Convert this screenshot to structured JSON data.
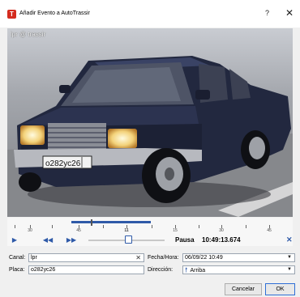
{
  "window": {
    "title": "Añadir Evento a AutoTrassir",
    "help": "?",
    "close": "✕",
    "app_icon_letter": "T"
  },
  "video": {
    "camera_label": "lpr @ trassir",
    "plate_text": "о282ус26"
  },
  "timeline": {
    "ticks": [
      "30",
      "45",
      "11",
      "15",
      "30",
      "45"
    ],
    "selected_range": [
      0.22,
      0.5
    ],
    "cursor_position": 0.3
  },
  "playback": {
    "play_icon": "play-icon",
    "prev_icon": "skip-back-icon",
    "next_icon": "skip-forward-icon",
    "slider_value": 0.55,
    "status": "Pausa",
    "time": "10:49:13.674",
    "close_icon": "close-icon"
  },
  "form": {
    "canal_label": "Canal:",
    "canal_value": "lpr",
    "placa_label": "Placa:",
    "placa_value": "о282ус26",
    "fecha_label": "Fecha/Hora:",
    "fecha_value": "06/09/22 10:49",
    "direccion_label": "Dirección:",
    "direccion_value": "Arriba"
  },
  "buttons": {
    "cancel": "Cancelar",
    "ok": "OK"
  },
  "colors": {
    "accent": "#2f5aa8",
    "app_icon": "#d42b1e"
  }
}
